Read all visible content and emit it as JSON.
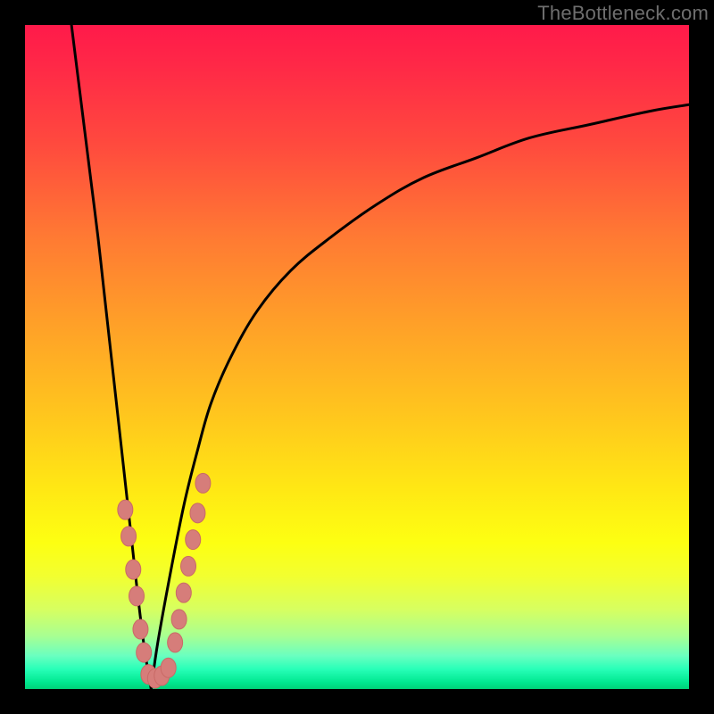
{
  "watermark": "TheBottleneck.com",
  "colors": {
    "frame": "#000000",
    "curve": "#000000",
    "bead_fill": "#d67d7a",
    "bead_stroke": "#c96a66",
    "gradient_top": "#ff1a4a",
    "gradient_bottom": "#00d178"
  },
  "chart_data": {
    "type": "line",
    "title": "",
    "xlabel": "",
    "ylabel": "",
    "xlim": [
      0,
      100
    ],
    "ylim": [
      0,
      100
    ],
    "grid": false,
    "notch_x": 19,
    "series": [
      {
        "name": "left_branch",
        "x": [
          7,
          8,
          9,
          10,
          11,
          12,
          13,
          14,
          15,
          16,
          17,
          18,
          19
        ],
        "y": [
          100,
          92,
          84,
          76,
          68,
          59,
          50,
          41,
          32,
          23,
          14,
          6,
          0
        ]
      },
      {
        "name": "right_branch",
        "x": [
          19,
          20,
          22,
          24,
          26,
          28,
          31,
          35,
          40,
          46,
          53,
          60,
          68,
          76,
          85,
          94,
          100
        ],
        "y": [
          0,
          7,
          18,
          28,
          36,
          43,
          50,
          57,
          63,
          68,
          73,
          77,
          80,
          83,
          85,
          87,
          88
        ]
      }
    ],
    "beads": [
      {
        "x": 15.1,
        "y": 27
      },
      {
        "x": 15.6,
        "y": 23
      },
      {
        "x": 16.3,
        "y": 18
      },
      {
        "x": 16.8,
        "y": 14
      },
      {
        "x": 17.4,
        "y": 9
      },
      {
        "x": 17.9,
        "y": 5.5
      },
      {
        "x": 18.6,
        "y": 2.2
      },
      {
        "x": 19.6,
        "y": 1.6
      },
      {
        "x": 20.6,
        "y": 2.0
      },
      {
        "x": 21.6,
        "y": 3.2
      },
      {
        "x": 22.6,
        "y": 7
      },
      {
        "x": 23.2,
        "y": 10.5
      },
      {
        "x": 23.9,
        "y": 14.5
      },
      {
        "x": 24.6,
        "y": 18.5
      },
      {
        "x": 25.3,
        "y": 22.5
      },
      {
        "x": 26.0,
        "y": 26.5
      },
      {
        "x": 26.8,
        "y": 31
      }
    ]
  }
}
